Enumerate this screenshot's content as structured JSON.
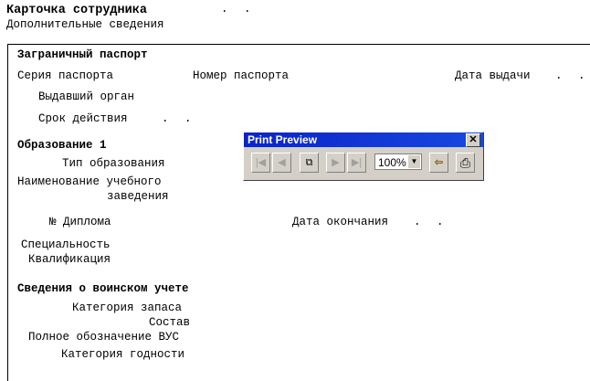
{
  "header": {
    "title": "Карточка сотрудника",
    "title_dots": ". .",
    "subtitle": "Дополнительные сведения"
  },
  "passport": {
    "heading": "Заграничный паспорт",
    "series": "Серия паспорта",
    "number": "Номер паспорта",
    "issue_date": "Дата выдачи",
    "issue_date_dots": ". .",
    "issuer": "Выдавший орган",
    "validity": "Срок действия",
    "validity_dots": ". ."
  },
  "education": {
    "heading": "Образование 1",
    "type": "Тип образования",
    "institution_1": "Наименование учебного",
    "institution_2": "заведения",
    "diploma": "№ Диплома",
    "end_date": "Дата окончания",
    "end_date_dots": ". .",
    "specialty": "Специальность",
    "qualification": "Квалификация"
  },
  "military": {
    "heading": "Сведения о воинском учете",
    "reserve_category": "Категория запаса",
    "composition": "Состав",
    "vus": "Полное обозначение ВУС",
    "fitness": "Категория годности"
  },
  "print_preview": {
    "title": "Print Preview",
    "zoom": "100%",
    "close": "✕",
    "first": "|◀",
    "prev": "◀",
    "pages": "⧉",
    "next": "▶",
    "last": "▶|",
    "exit": "⇦",
    "print": "⎙"
  }
}
